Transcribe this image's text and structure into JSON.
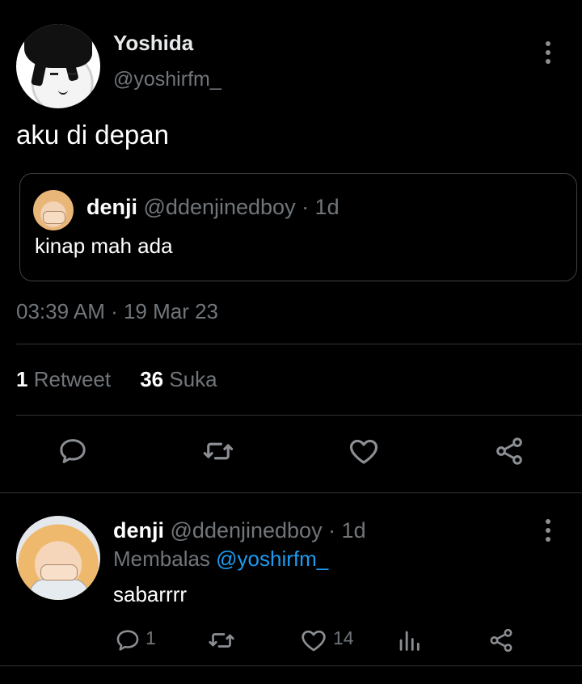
{
  "main_tweet": {
    "author_name": "Yoshida",
    "author_handle": "@yoshirfm_",
    "text": "aku di depan",
    "timestamp": "03:39 AM · 19 Mar 23",
    "stats": {
      "retweets_count": "1",
      "retweets_label": "Retweet",
      "likes_count": "36",
      "likes_label": "Suka"
    }
  },
  "quoted_tweet": {
    "author_name": "denji",
    "meta": " @ddenjinedboy · 1d",
    "text": "kinap mah ada"
  },
  "reply": {
    "author_name": "denji",
    "meta": " @ddenjinedboy · 1d",
    "replying_label": "Membalas ",
    "replying_to": "@yoshirfm_",
    "text": "sabarrrr",
    "reply_count": "1",
    "like_count": "14"
  },
  "icons": {
    "reply": "reply-icon",
    "retweet": "retweet-icon",
    "like": "heart-icon",
    "share": "share-icon",
    "analytics": "analytics-icon",
    "more": "more-vertical-icon"
  },
  "colors": {
    "background": "#000000",
    "text_primary": "#e7e9ea",
    "text_secondary": "#71767b",
    "accent": "#1d9bf0",
    "divider": "#2f3336"
  }
}
